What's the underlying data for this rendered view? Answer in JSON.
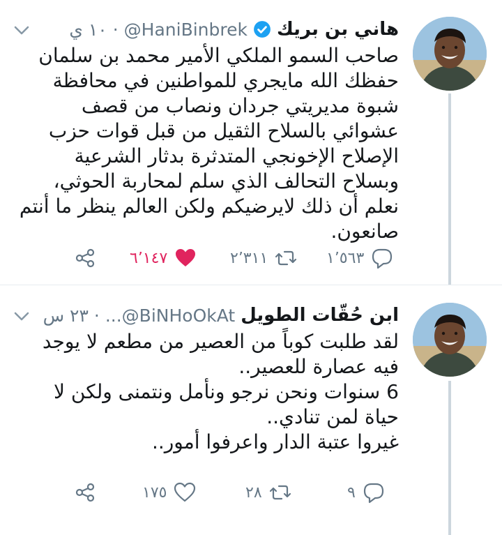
{
  "tweets": [
    {
      "name": "هاني بن بريك",
      "handle": "@HaniBinbrek",
      "time": "١٠ ي",
      "verified": true,
      "text": [
        "صاحب السمو الملكي الأمير محمد بن سلمان حفظك الله مايجري للمواطنين في محافظة شبوة مديريتي جردان ونصاب من قصف عشوائي بالسلاح الثقيل من قبل قوات حزب الإصلاح الإخونجي المتدثرة بدثار الشرعية وبسلاح التحالف الذي سلم لمحاربة الحوثي، نعلم أن ذلك لايرضيكم ولكن العالم ينظر ما أنتم صانعون."
      ],
      "replies": "١٬٥٦٣",
      "retweets": "٢٬٣١١",
      "likes": "٦٬١٤٧",
      "liked": true
    },
    {
      "name": "ابن حُقّات الطويل",
      "handle": "...@BiNHoOkAt",
      "time": "٢٣ س",
      "verified": false,
      "text": [
        "لقد طلبت كوباً من العصير من مطعم لا يوجد فيه عصارة للعصير..",
        "6 سنوات ونحن نرجو ونأمل ونتمنى ولكن لا حياة لمن تنادي..",
        "غيروا عتبة الدار واعرفوا أمور.."
      ],
      "replies": "٩",
      "retweets": "٢٨",
      "likes": "١٧٥",
      "liked": false
    }
  ],
  "colors": {
    "secondary": "#657786",
    "like": "#e0245e",
    "verified": "#1da1f2",
    "thread": "#ccd6dd"
  }
}
